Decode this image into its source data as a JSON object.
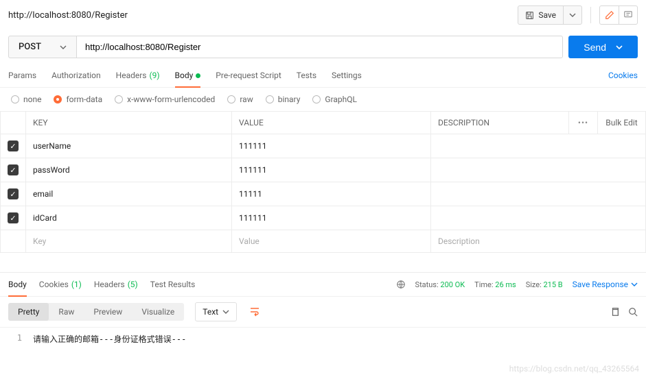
{
  "header": {
    "title": "http://localhost:8080/Register",
    "save_label": "Save"
  },
  "request": {
    "method": "POST",
    "url": "http://localhost:8080/Register",
    "send_label": "Send"
  },
  "req_tabs": {
    "params": "Params",
    "authorization": "Authorization",
    "headers": "Headers",
    "headers_count": "(9)",
    "body": "Body",
    "prerequest": "Pre-request Script",
    "tests": "Tests",
    "settings": "Settings",
    "cookies_link": "Cookies"
  },
  "body_types": {
    "none": "none",
    "formdata": "form-data",
    "urlencoded": "x-www-form-urlencoded",
    "raw": "raw",
    "binary": "binary",
    "graphql": "GraphQL"
  },
  "kv_headers": {
    "key": "KEY",
    "value": "VALUE",
    "description": "DESCRIPTION",
    "bulk": "Bulk Edit"
  },
  "kv_rows": [
    {
      "key": "userName",
      "value": "111111",
      "desc": ""
    },
    {
      "key": "passWord",
      "value": "111111",
      "desc": ""
    },
    {
      "key": "email",
      "value": "11111",
      "desc": ""
    },
    {
      "key": "idCard",
      "value": "111111",
      "desc": ""
    }
  ],
  "kv_placeholder": {
    "key": "Key",
    "value": "Value",
    "desc": "Description"
  },
  "resp_tabs": {
    "body": "Body",
    "cookies": "Cookies",
    "cookies_count": "(1)",
    "headers": "Headers",
    "headers_count": "(5)",
    "test_results": "Test Results"
  },
  "resp_info": {
    "status_label": "Status:",
    "status_value": "200 OK",
    "time_label": "Time:",
    "time_value": "26 ms",
    "size_label": "Size:",
    "size_value": "215 B",
    "save_response": "Save Response"
  },
  "resp_views": {
    "pretty": "Pretty",
    "raw": "Raw",
    "preview": "Preview",
    "visualize": "Visualize",
    "format": "Text"
  },
  "resp_body": {
    "line": "1",
    "text": "请输入正确的邮箱---身份证格式错误---"
  },
  "watermark": "https://blog.csdn.net/qq_43265564"
}
